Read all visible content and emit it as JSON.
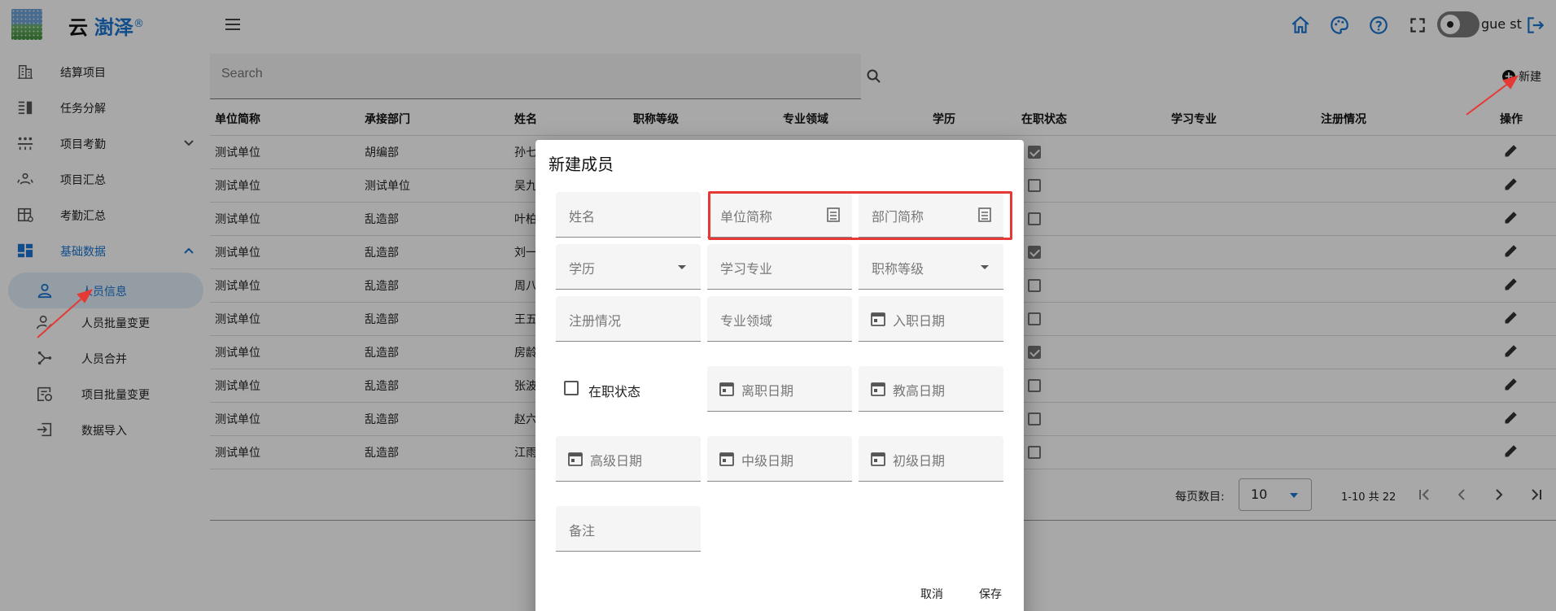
{
  "header": {
    "logo_char": "云",
    "brand": "澍泽",
    "brand_mark": "®",
    "username": "gue st"
  },
  "sidebar": {
    "items": [
      {
        "label": "结算项目"
      },
      {
        "label": "任务分解"
      },
      {
        "label": "项目考勤"
      },
      {
        "label": "项目汇总"
      },
      {
        "label": "考勤汇总"
      },
      {
        "label": "基础数据"
      },
      {
        "label": "人员信息"
      },
      {
        "label": "人员批量变更"
      },
      {
        "label": "人员合并"
      },
      {
        "label": "项目批量变更"
      },
      {
        "label": "数据导入"
      }
    ]
  },
  "toolbar": {
    "search_placeholder": "Search",
    "new_label": "新建"
  },
  "table": {
    "headers": [
      "单位简称",
      "承接部门",
      "姓名",
      "职称等级",
      "专业领域",
      "学历",
      "在职状态",
      "学习专业",
      "注册情况",
      "操作"
    ],
    "rows": [
      {
        "unit": "测试单位",
        "dept": "胡编部",
        "name": "孙七",
        "active": true
      },
      {
        "unit": "测试单位",
        "dept": "测试单位",
        "name": "吴九",
        "active": false
      },
      {
        "unit": "测试单位",
        "dept": "乱造部",
        "name": "叶柏",
        "active": false
      },
      {
        "unit": "测试单位",
        "dept": "乱造部",
        "name": "刘一",
        "active": true
      },
      {
        "unit": "测试单位",
        "dept": "乱造部",
        "name": "周八",
        "active": false
      },
      {
        "unit": "测试单位",
        "dept": "乱造部",
        "name": "王五",
        "active": false
      },
      {
        "unit": "测试单位",
        "dept": "乱造部",
        "name": "房龄",
        "active": true
      },
      {
        "unit": "测试单位",
        "dept": "乱造部",
        "name": "张波",
        "active": false
      },
      {
        "unit": "测试单位",
        "dept": "乱造部",
        "name": "赵六",
        "active": false
      },
      {
        "unit": "测试单位",
        "dept": "乱造部",
        "name": "江雨",
        "active": false
      }
    ]
  },
  "pager": {
    "label": "每页数目:",
    "per_page": "10",
    "range": "1-10 共 22"
  },
  "dialog": {
    "title": "新建成员",
    "fields": {
      "name": "姓名",
      "unit": "单位简称",
      "dept": "部门简称",
      "education": "学历",
      "major": "学习专业",
      "title_level": "职称等级",
      "registration": "注册情况",
      "field": "专业领域",
      "hire_date": "入职日期",
      "active": "在职状态",
      "leave_date": "离职日期",
      "prof_senior_date": "教高日期",
      "senior_date": "高级日期",
      "mid_date": "中级日期",
      "junior_date": "初级日期",
      "remark": "备注"
    },
    "cancel": "取消",
    "save": "保存"
  },
  "colors": {
    "primary": "#1976d2",
    "annotation": "#e53935"
  }
}
